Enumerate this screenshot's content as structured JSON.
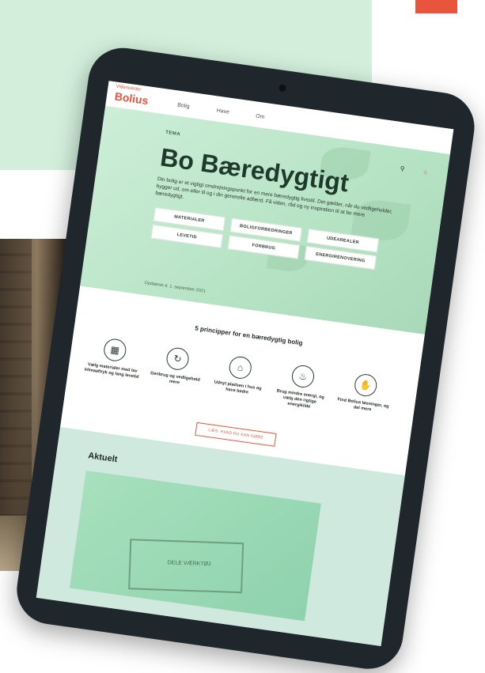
{
  "brand": {
    "small": "Videncenter",
    "name": "Bolius"
  },
  "nav": [
    "Bolig",
    "Have",
    "Om"
  ],
  "header_icons": [
    "search-icon",
    "home-icon"
  ],
  "hero": {
    "tag": "TEMA",
    "title": "Bo Bæredygtigt",
    "lede": "Din bolig er et vigtigt omdrejningspunkt for en mere bæredygtig livsstil. Det gælder, når du vedligeholder, bygger ud, om eller til og i din generelle adfærd. Få viden, råd og ny inspiration til at bo mere bæredygtigt.",
    "buttons": [
      "MATERIALER",
      "BOLIGFORBEDRINGER",
      "UDEAREALER",
      "LEVETID",
      "FORBRUG",
      "ENERGIRENOVERING"
    ],
    "updated": "Opdateret d. 1. september 2021"
  },
  "principles": {
    "title": "5 principper for en bæredygtig bolig",
    "items": [
      {
        "icon": "building-materials-icon",
        "text": "Vælg materialer med lav klimaaftryk og lang levetid"
      },
      {
        "icon": "recycle-icon",
        "text": "Genbrug og vedligehold mere"
      },
      {
        "icon": "house-leaf-icon",
        "text": "Udnyt pladsen i hus og have bedre"
      },
      {
        "icon": "energy-drop-icon",
        "text": "Brug mindre energi, og vælg den rigtige energikilde"
      },
      {
        "icon": "hand-icon",
        "text": "Find Bolius løsninger, og del mere"
      }
    ],
    "cta": "LÆS, HVAD DU KAN GØRE"
  },
  "news": {
    "title": "Aktuelt",
    "image_label": "DELE VÆRKTØJ"
  },
  "colors": {
    "accent": "#e8553c",
    "mint": "#d3efdc",
    "hero": "#b6e3c4",
    "dark": "#1f3a2b"
  }
}
